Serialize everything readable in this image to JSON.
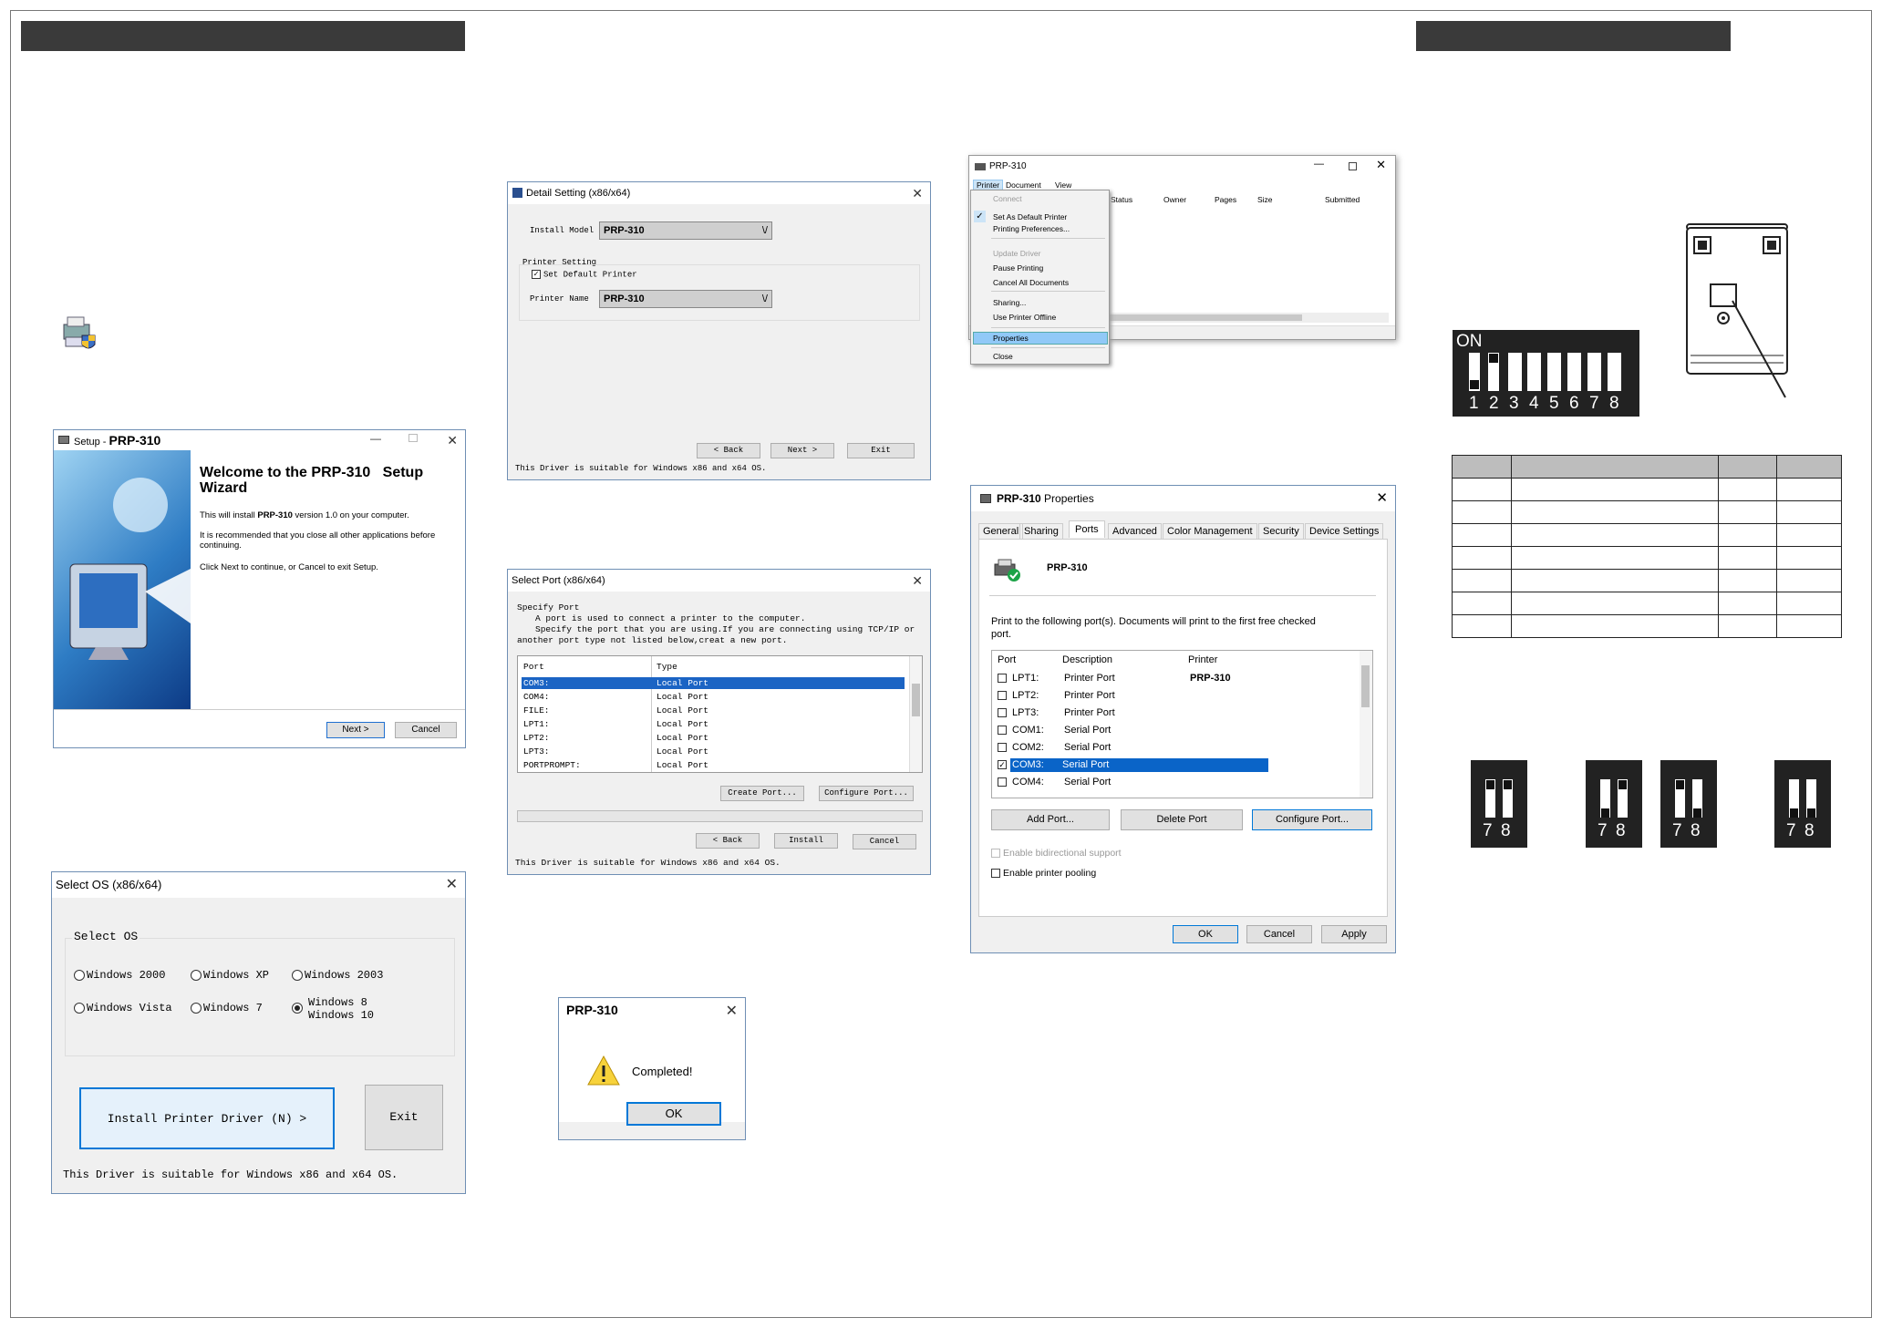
{
  "setup": {
    "title": "Setup - ",
    "title_bold": "PRP-310",
    "welcome1": "Welcome to the ",
    "product": "PRP-310",
    "welcome2": "Setup",
    "wizard": "Wizard",
    "p1a": "This will install ",
    "p1b": "PRP-310",
    "p1c": " version 1.0 on your computer.",
    "p2": "It is recommended that you close all other applications before continuing.",
    "p3": "Click Next to continue, or Cancel to exit Setup.",
    "next": "Next >",
    "cancel": "Cancel"
  },
  "selectos": {
    "title": "Select OS (x86/x64)",
    "group": "Select OS",
    "options": [
      "Windows 2000",
      "Windows XP",
      "Windows 2003",
      "Windows Vista",
      "Windows 7",
      "Windows 8",
      "Windows 10"
    ],
    "selected": "Windows 8 Windows 10",
    "install": "Install Printer Driver (N) >",
    "exit": "Exit",
    "note": "This Driver is suitable for Windows x86 and x64 OS."
  },
  "detail": {
    "title": "Detail Setting (x86/x64)",
    "install_model_label": "Install Model",
    "install_model": "PRP-310",
    "printer_setting": "Printer Setting",
    "set_default": "Set Default Printer",
    "printer_name_label": "Printer Name",
    "printer_name": "PRP-310",
    "back": "< Back",
    "next": "Next >",
    "exit": "Exit",
    "note": "This Driver is suitable for Windows x86 and x64 OS."
  },
  "selectport": {
    "title": "Select Port (x86/x64)",
    "specify": "Specify Port",
    "desc1": "A port is used to connect a printer to the computer.",
    "desc2": "Specify the port that you are using.If you are connecting using TCP/IP or",
    "desc3": "another port type not listed below,creat a new port.",
    "col_port": "Port",
    "col_type": "Type",
    "ports": [
      "COM3:",
      "COM4:",
      "FILE:",
      "LPT1:",
      "LPT2:",
      "LPT3:",
      "PORTPROMPT:"
    ],
    "types": [
      "Local Port",
      "Local Port",
      "Local Port",
      "Local Port",
      "Local Port",
      "Local Port",
      "Local Port"
    ],
    "create": "Create Port...",
    "configure": "Configure Port...",
    "back": "< Back",
    "install": "Install",
    "cancel": "Cancel",
    "note": "This Driver is suitable for Windows x86 and x64 OS."
  },
  "completed": {
    "title": "PRP-310",
    "message": "Completed!",
    "ok": "OK"
  },
  "queue": {
    "title": "PRP-310",
    "menus": [
      "Printer",
      "Document",
      "View"
    ],
    "items": [
      "Connect",
      "Set As Default Printer",
      "Printing Preferences...",
      "Update Driver",
      "Pause Printing",
      "Cancel All Documents",
      "Sharing...",
      "Use Printer Offline",
      "Properties",
      "Close"
    ],
    "cols": [
      "Status",
      "Owner",
      "Pages",
      "Size",
      "Submitted"
    ]
  },
  "props": {
    "title_bold": "PRP-310",
    "title": " Properties",
    "tabs": [
      "General",
      "Sharing",
      "Ports",
      "Advanced",
      "Color Management",
      "Security",
      "Device Settings"
    ],
    "printer": "PRP-310",
    "instruction": "Print to the following port(s). Documents will print to the first free checked port.",
    "col_port": "Port",
    "col_desc": "Description",
    "col_printer": "Printer",
    "ports": [
      "LPT1:",
      "LPT2:",
      "LPT3:",
      "COM1:",
      "COM2:",
      "COM3:",
      "COM4:"
    ],
    "descs": [
      "Printer Port",
      "Printer Port",
      "Printer Port",
      "Serial Port",
      "Serial Port",
      "Serial Port",
      "Serial Port"
    ],
    "first_printer": "PRP-310",
    "add": "Add Port...",
    "delete": "Delete Port",
    "configure": "Configure Port...",
    "bidi": "Enable bidirectional support",
    "pool": "Enable printer pooling",
    "ok": "OK",
    "cancel": "Cancel",
    "apply": "Apply"
  },
  "dip": {
    "on": "ON",
    "numbers": [
      "1",
      "2",
      "3",
      "4",
      "5",
      "6",
      "7",
      "8"
    ],
    "pair": [
      "7",
      "8"
    ]
  }
}
